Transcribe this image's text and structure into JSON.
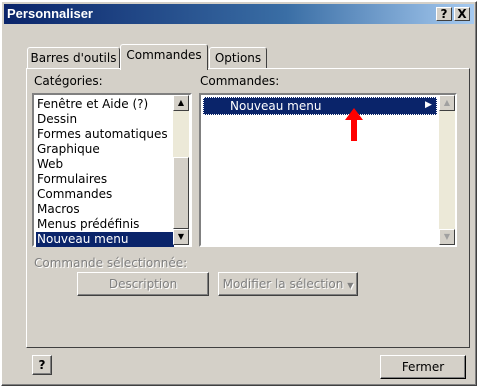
{
  "window": {
    "title": "Personnaliser"
  },
  "title_buttons": {
    "help": "?",
    "close": "X"
  },
  "tabs": [
    {
      "label": "Barres d'outils"
    },
    {
      "label": "Commandes"
    },
    {
      "label": "Options"
    }
  ],
  "categories": {
    "label": "Catégories:",
    "items": [
      "Fenêtre et Aide (?)",
      "Dessin",
      "Formes automatiques",
      "Graphique",
      "Web",
      "Formulaires",
      "Commandes",
      "Macros",
      "Menus prédéfinis",
      "Nouveau menu"
    ],
    "selected": "Nouveau menu"
  },
  "commands": {
    "label": "Commandes:",
    "items": [
      "Nouveau menu"
    ],
    "selected": "Nouveau menu"
  },
  "selected_command": {
    "label": "Commande sélectionnée:",
    "description_button": "Description",
    "modify_button": "Modifier la sélection"
  },
  "footer": {
    "help_icon": "?",
    "close_button": "Fermer"
  },
  "colors": {
    "selection": "#0a246a",
    "annotation_arrow": "#ff0000",
    "face": "#d4d0c8"
  }
}
